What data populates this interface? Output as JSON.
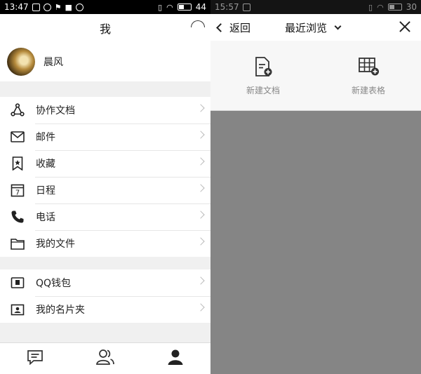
{
  "left_screen": {
    "status": {
      "time": "13:47",
      "battery": "44"
    },
    "header": {
      "title": "我"
    },
    "profile": {
      "name": "晨风"
    },
    "group1": [
      {
        "label": "协作文档",
        "icon": "share-nodes-icon"
      },
      {
        "label": "邮件",
        "icon": "mail-icon"
      },
      {
        "label": "收藏",
        "icon": "bookmark-star-icon"
      },
      {
        "label": "日程",
        "icon": "calendar-icon"
      },
      {
        "label": "电话",
        "icon": "phone-icon"
      },
      {
        "label": "我的文件",
        "icon": "folder-icon"
      }
    ],
    "group2": [
      {
        "label": "QQ钱包",
        "icon": "wallet-icon"
      },
      {
        "label": "我的名片夹",
        "icon": "card-holder-icon"
      }
    ],
    "calendar_day": "7",
    "tabs": [
      "message-icon",
      "contacts-icon",
      "profile-icon"
    ]
  },
  "right_screen": {
    "status": {
      "time": "15:57",
      "battery": "30"
    },
    "header": {
      "back_label": "返回",
      "title": "最近浏览"
    },
    "actions": [
      {
        "label": "新建文档",
        "icon": "new-doc-icon"
      },
      {
        "label": "新建表格",
        "icon": "new-sheet-icon"
      }
    ],
    "colors": {
      "overlay": "#858585",
      "accent": "#222222"
    }
  }
}
